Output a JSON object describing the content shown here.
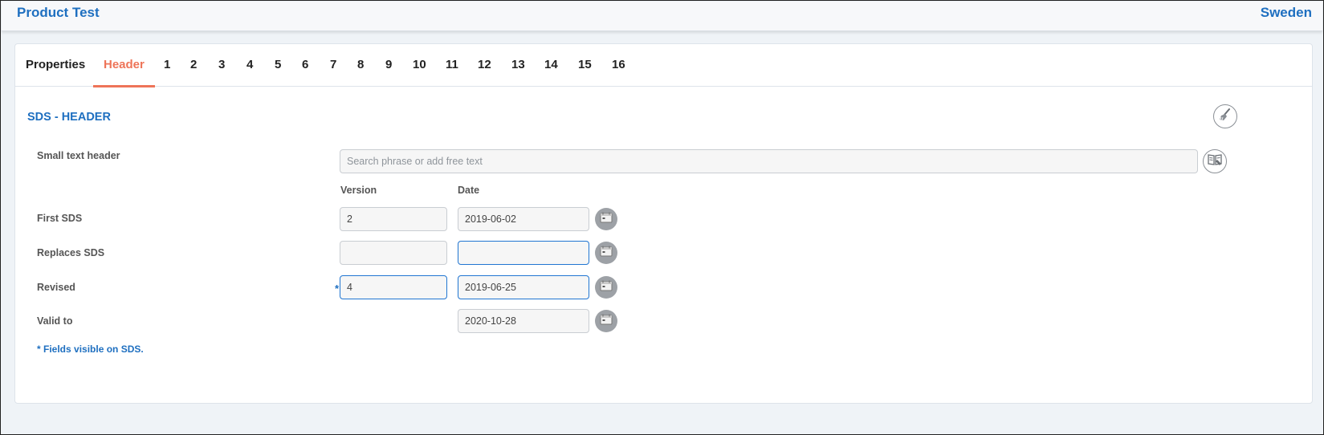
{
  "header": {
    "title": "Product Test",
    "region": "Sweden"
  },
  "tabs": [
    "Properties",
    "Header",
    "1",
    "2",
    "3",
    "4",
    "5",
    "6",
    "7",
    "8",
    "9",
    "10",
    "11",
    "12",
    "13",
    "14",
    "15",
    "16"
  ],
  "active_tab": "Header",
  "section": {
    "title": "SDS - HEADER"
  },
  "form": {
    "small_text_header": {
      "label": "Small text header",
      "placeholder": "Search phrase or add free text",
      "value": ""
    },
    "columns": {
      "version": "Version",
      "date": "Date"
    },
    "rows": {
      "first_sds": {
        "label": "First SDS",
        "version": "2",
        "date": "2019-06-02"
      },
      "replaces_sds": {
        "label": "Replaces SDS",
        "version": "",
        "date": ""
      },
      "revised": {
        "label": "Revised",
        "version": "4",
        "date": "2019-06-25",
        "required_marker": "*"
      },
      "valid_to": {
        "label": "Valid to",
        "date": "2020-10-28"
      }
    },
    "footnote": "* Fields visible on SDS."
  },
  "icons": {
    "clear": "broom-icon",
    "phrase_book": "book-icon",
    "calendar": "calendar-icon"
  },
  "colors": {
    "brand_blue": "#1e6fc0",
    "active_tab": "#ee7458",
    "focus_border": "#2176d2"
  }
}
